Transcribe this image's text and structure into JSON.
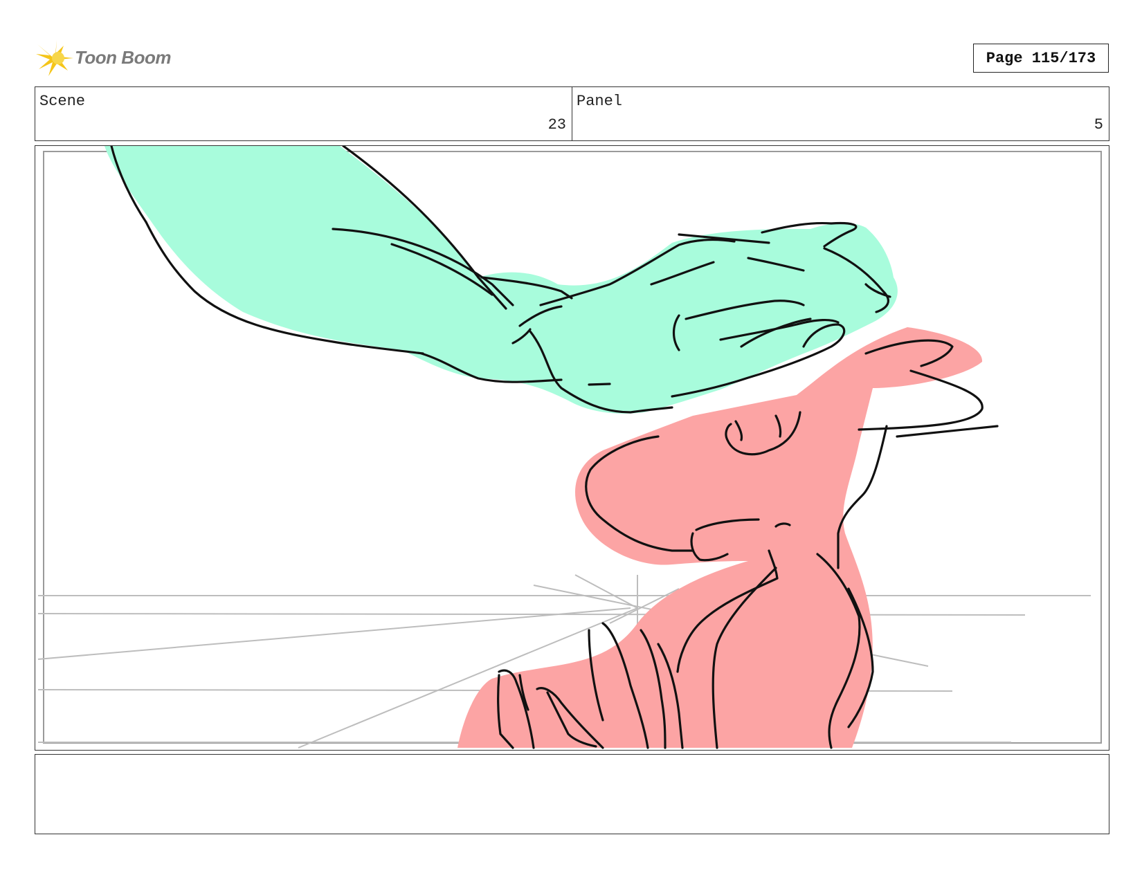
{
  "header": {
    "logo_text": "Toon Boom",
    "page_label": "Page 115/173"
  },
  "info": {
    "scene_label": "Scene",
    "scene_value": "23",
    "panel_label": "Panel",
    "panel_value": "5"
  },
  "colors": {
    "hand_fill": "#a8fcdc",
    "character_fill": "#fca4a4",
    "ink": "#111111",
    "guide_lines": "#bdbdbd"
  },
  "caption": {
    "text": ""
  }
}
